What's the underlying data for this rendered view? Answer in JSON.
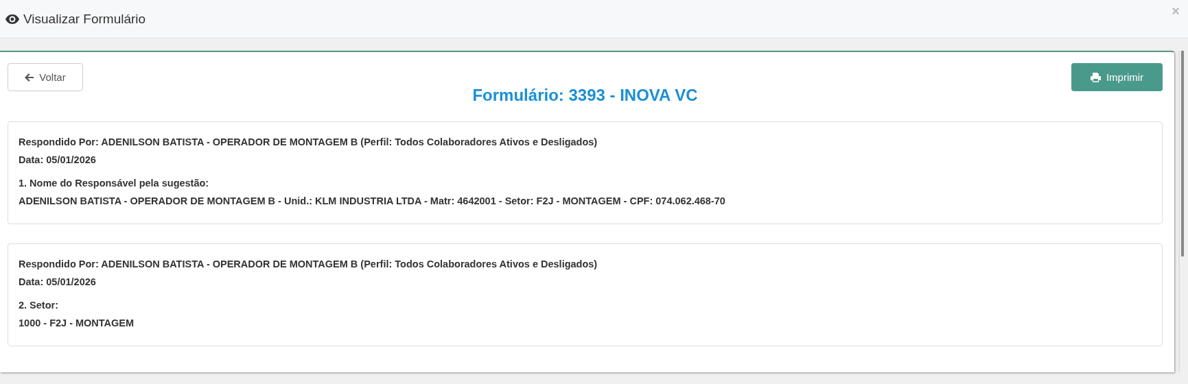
{
  "window": {
    "title": "Visualizar Formulário",
    "close": "×"
  },
  "toolbar": {
    "back": "Voltar",
    "print": "Imprimir"
  },
  "heading": "Formulário: 3393 - INOVA VC",
  "answers": [
    {
      "responded_by": "Respondido Por: ADENILSON BATISTA - OPERADOR DE MONTAGEM B (Perfil: Todos Colaboradores Ativos e Desligados)",
      "date": "Data: 05/01/2026",
      "question": "1. Nome do Responsável pela sugestão:",
      "answer": "ADENILSON BATISTA - OPERADOR DE MONTAGEM B - Unid.: KLM INDUSTRIA LTDA - Matr: 4642001 - Setor: F2J - MONTAGEM - CPF: 074.062.468-70"
    },
    {
      "responded_by": "Respondido Por: ADENILSON BATISTA - OPERADOR DE MONTAGEM B (Perfil: Todos Colaboradores Ativos e Desligados)",
      "date": "Data: 05/01/2026",
      "question": "2. Setor:",
      "answer": "1000 - F2J - MONTAGEM"
    }
  ]
}
